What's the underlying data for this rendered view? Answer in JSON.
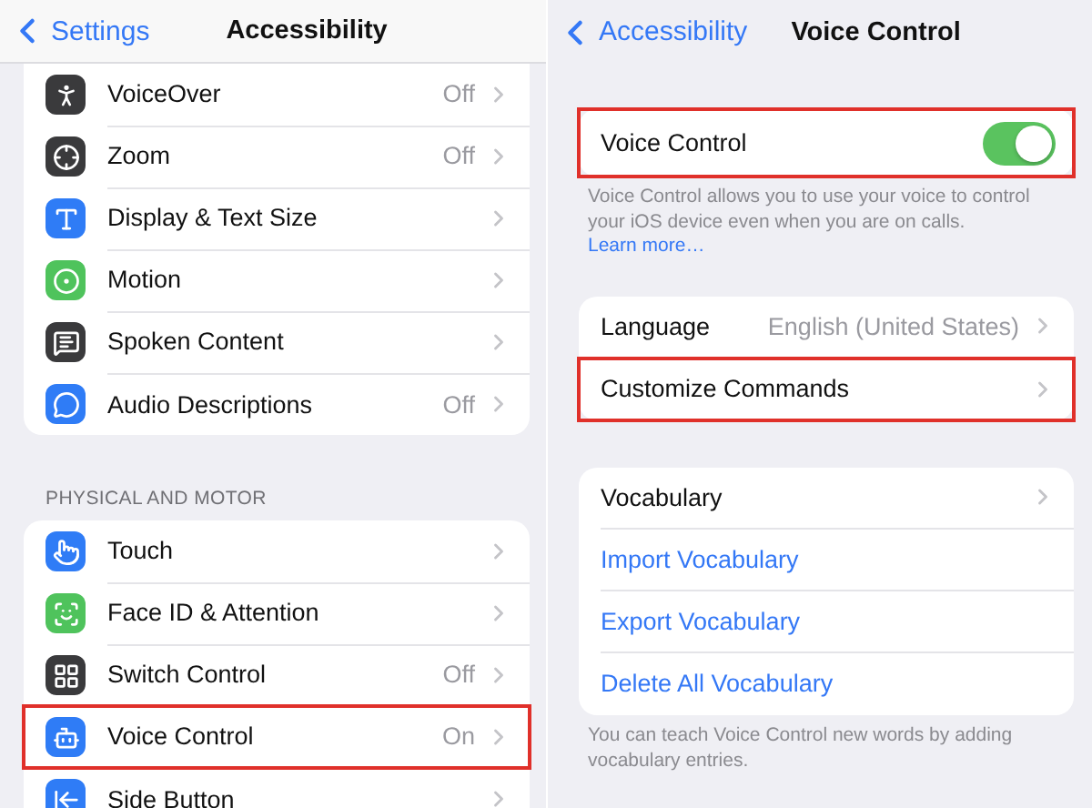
{
  "left": {
    "nav": {
      "back": "Settings",
      "title": "Accessibility"
    },
    "groups": [
      {
        "rows": [
          {
            "label": "VoiceOver",
            "value": "Off",
            "color": "#3a3a3c",
            "highlighted": false
          },
          {
            "label": "Zoom",
            "value": "Off",
            "color": "#3a3a3c",
            "highlighted": false
          },
          {
            "label": "Display & Text Size",
            "color": "#2f7cf6",
            "highlighted": false
          },
          {
            "label": "Motion",
            "color": "#4fc35c",
            "highlighted": false
          },
          {
            "label": "Spoken Content",
            "color": "#3a3a3c",
            "highlighted": false
          },
          {
            "label": "Audio Descriptions",
            "value": "Off",
            "color": "#2f7cf6",
            "highlighted": false
          }
        ]
      },
      {
        "header": "PHYSICAL AND MOTOR",
        "rows": [
          {
            "label": "Touch",
            "color": "#2f7cf6",
            "highlighted": false
          },
          {
            "label": "Face ID & Attention",
            "color": "#4fc35c",
            "highlighted": false
          },
          {
            "label": "Switch Control",
            "value": "Off",
            "color": "#3a3a3c",
            "highlighted": false
          },
          {
            "label": "Voice Control",
            "value": "On",
            "color": "#2f7cf6",
            "highlighted": true
          },
          {
            "label": "Side Button",
            "color": "#2f7cf6",
            "highlighted": false
          }
        ]
      }
    ]
  },
  "right": {
    "nav": {
      "back": "Accessibility",
      "title": "Voice Control"
    },
    "groups": [
      {
        "rows": [
          {
            "kind": "toggle",
            "label": "Voice Control",
            "on": true,
            "highlighted": true
          }
        ],
        "footer": "Voice Control allows you to use your voice to control your iOS device even when you are on calls.",
        "footer_link": "Learn more…"
      },
      {
        "rows": [
          {
            "kind": "nav",
            "label": "Language",
            "value": "English (United States)",
            "highlighted": false
          },
          {
            "kind": "nav",
            "label": "Customize Commands",
            "highlighted": true
          }
        ]
      },
      {
        "rows": [
          {
            "kind": "nav",
            "label": "Vocabulary",
            "highlighted": false
          },
          {
            "kind": "action",
            "label": "Import Vocabulary"
          },
          {
            "kind": "action",
            "label": "Export Vocabulary"
          },
          {
            "kind": "action",
            "label": "Delete All Vocabulary"
          }
        ],
        "footer": "You can teach Voice Control new words by adding vocabulary entries."
      }
    ]
  }
}
